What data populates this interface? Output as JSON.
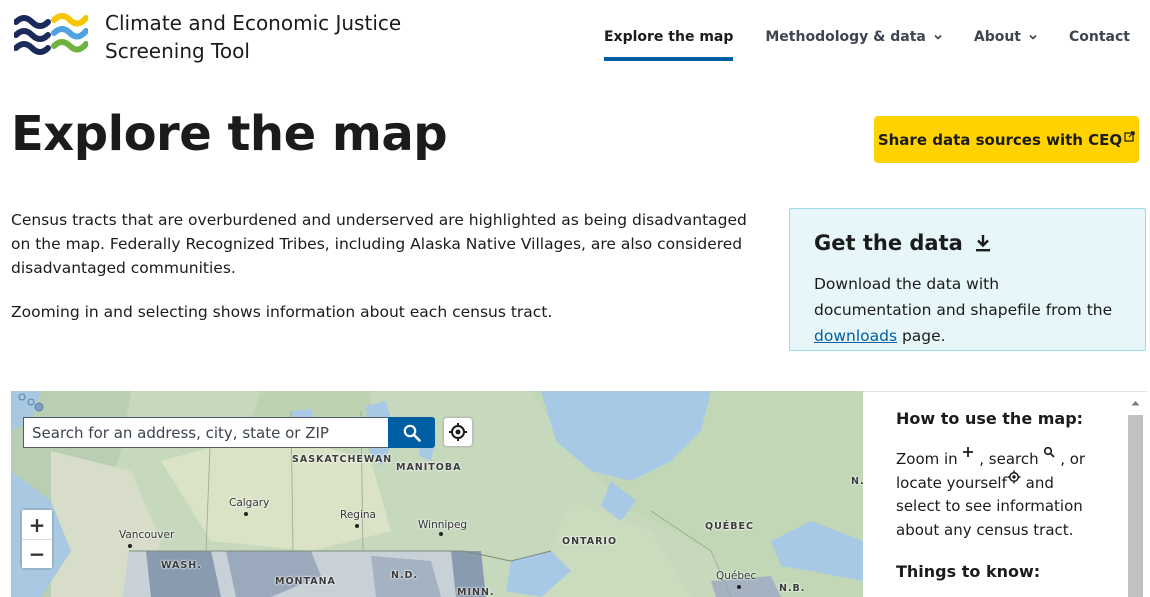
{
  "header": {
    "title_line1": "Climate and Economic Justice",
    "title_line2": "Screening Tool",
    "nav": [
      {
        "label": "Explore the map",
        "active": true
      },
      {
        "label": "Methodology & data",
        "dropdown": true
      },
      {
        "label": "About",
        "dropdown": true
      },
      {
        "label": "Contact"
      }
    ]
  },
  "page": {
    "title": "Explore the map",
    "share_button": "Share data sources with CEQ",
    "intro_p1": "Census tracts that are overburdened and underserved are highlighted as being disadvantaged on the map. Federally Recognized Tribes, including Alaska Native Villages, are also considered disadvantaged communities.",
    "intro_p2": "Zooming in and selecting shows information about each census tract."
  },
  "get_data": {
    "title": "Get the data",
    "text_before": "Download the data with documentation and shapefile from the ",
    "link": "downloads",
    "text_after": " page."
  },
  "map": {
    "search_placeholder": "Search for an address, city, state or ZIP",
    "zoom_in": "+",
    "zoom_out": "−",
    "labels": {
      "saskatchewan": "SASKATCHEWAN",
      "manitoba": "MANITOBA",
      "calgary": "Calgary",
      "regina": "Regina",
      "winnipeg": "Winnipeg",
      "vancouver": "Vancouver",
      "quebec_prov": "QUÉBEC",
      "ontario": "ONTARIO",
      "quebec_city": "Québec",
      "wash": "WASH.",
      "montana": "MONTANA",
      "nd": "N.D.",
      "minn": "MINN.",
      "nb": "N.B.",
      "nl": "N."
    }
  },
  "side_panel": {
    "heading": "How to use the map:",
    "zoom_text": "Zoom in",
    "search_text": ", search",
    "or_text": ", or",
    "locate_text": "locate yourself",
    "and_text": "and select to see information about any census tract.",
    "things_heading": "Things to know:"
  },
  "colors": {
    "accent": "#005ea2",
    "share_button": "#ffd200",
    "data_box_bg": "#e7f6f8",
    "disadvantaged_tract": "#8a9bb0"
  }
}
